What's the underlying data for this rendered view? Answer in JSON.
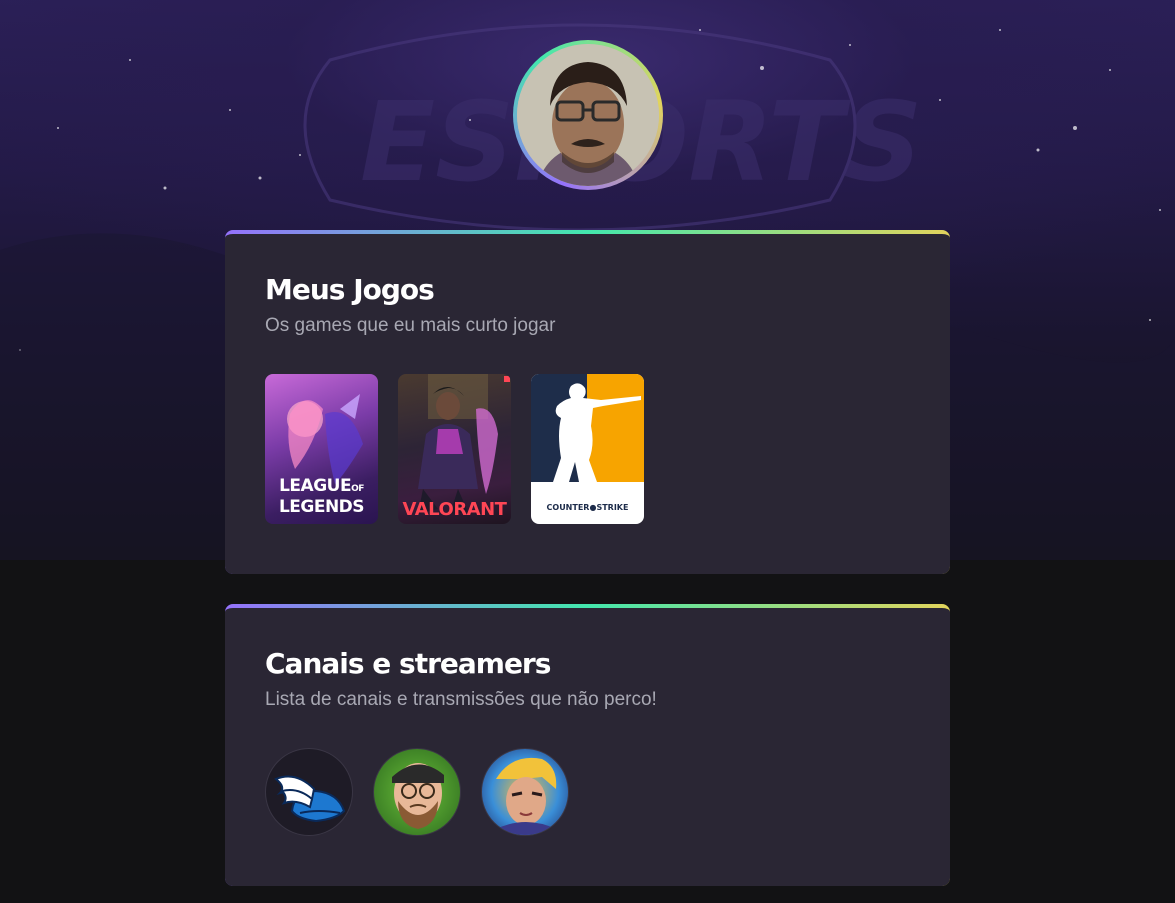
{
  "profile": {
    "avatar_alt": "Foto de perfil"
  },
  "games_section": {
    "title": "Meus Jogos",
    "subtitle": "Os games que eu mais curto jogar",
    "games": [
      {
        "name": "LEAGUE OF LEGENDS",
        "icon": "league-of-legends-cover"
      },
      {
        "name": "VALORANT",
        "icon": "valorant-cover"
      },
      {
        "name": "COUNTER STRIKE",
        "icon": "counter-strike-cover"
      }
    ]
  },
  "streamers_section": {
    "title": "Canais e streamers",
    "subtitle": "Lista de canais e transmissões que não perco!",
    "streamers": [
      {
        "icon": "winged-helmet-avatar"
      },
      {
        "icon": "cartoon-bearded-man-avatar"
      },
      {
        "icon": "cartoon-blond-man-avatar"
      }
    ]
  },
  "colors": {
    "background": "#121214",
    "card": "#2a2634",
    "gradient": [
      "#9572fc",
      "#43e7ad",
      "#e2d45c"
    ],
    "title": "#ffffff",
    "subtitle": "#a8a8b3"
  }
}
